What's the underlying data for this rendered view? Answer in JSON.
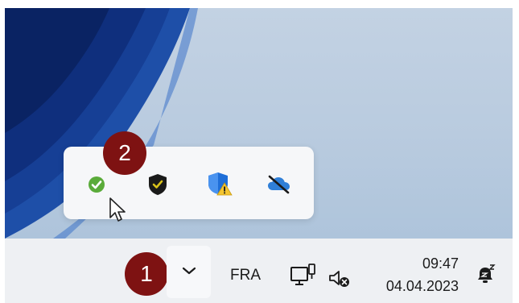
{
  "callouts": {
    "step1": "1",
    "step2": "2"
  },
  "taskbar": {
    "language": "FRA",
    "clock_time": "09:47",
    "clock_date": "04.04.2023"
  },
  "overflow_flyout": {
    "icons": [
      "check-circle-icon",
      "shield-check-icon",
      "security-warning-icon",
      "onedrive-offline-icon"
    ]
  },
  "system_tray_icons": [
    "show-hidden-icons-chevron",
    "network-icon",
    "speaker-muted-icon",
    "notification-bell-icon"
  ],
  "colors": {
    "callout": "#7e1212",
    "taskbar": "#eef0f3",
    "check_green": "#5aab3a",
    "defender_blue": "#1e6ed8",
    "warning_yellow": "#f4c531"
  }
}
